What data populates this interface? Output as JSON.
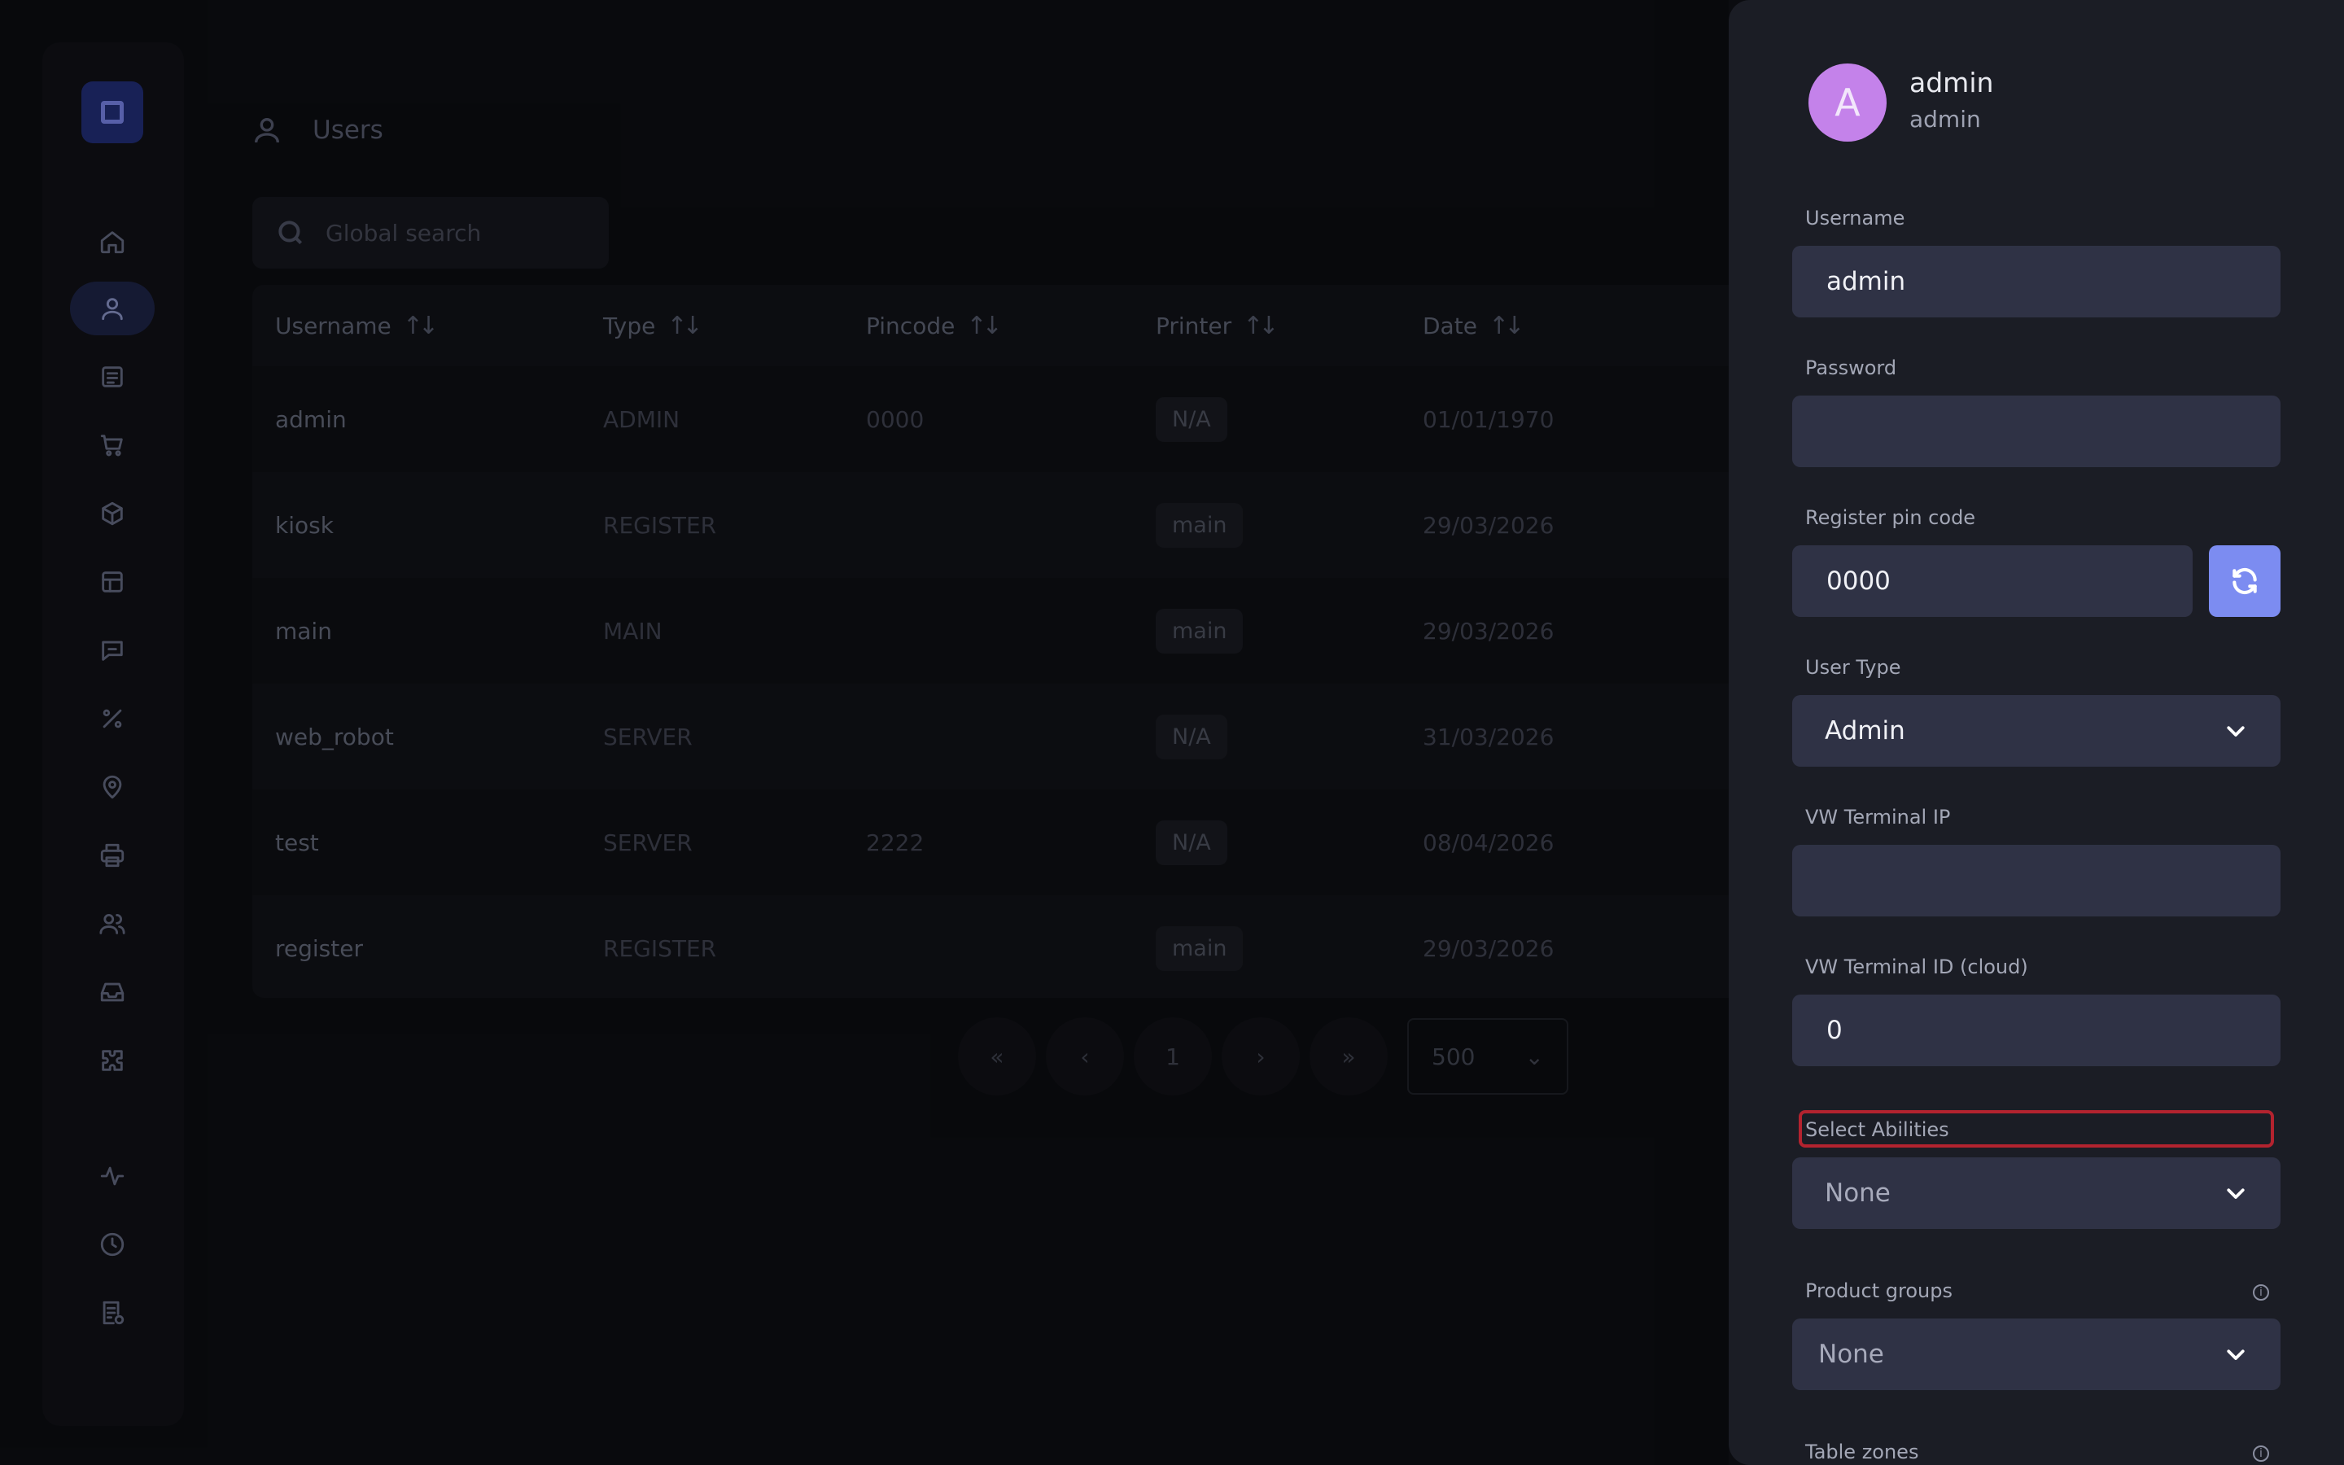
{
  "header": {
    "title": "Users",
    "search_placeholder": "Global search"
  },
  "sidebar": {
    "items": [
      {
        "icon": "home-icon"
      },
      {
        "icon": "user-icon",
        "active": true
      },
      {
        "icon": "receipt-icon"
      },
      {
        "icon": "cart-icon"
      },
      {
        "icon": "package-icon"
      },
      {
        "icon": "table-icon"
      },
      {
        "icon": "message-icon"
      },
      {
        "icon": "percent-icon"
      },
      {
        "icon": "location-icon"
      },
      {
        "icon": "printer-icon"
      },
      {
        "icon": "users-icon"
      },
      {
        "icon": "inbox-icon"
      },
      {
        "icon": "puzzle-icon"
      },
      {
        "icon": "activity-icon"
      },
      {
        "icon": "clock-icon"
      },
      {
        "icon": "report-icon"
      }
    ]
  },
  "table": {
    "columns": [
      "Username",
      "Type",
      "Pincode",
      "Printer",
      "Date"
    ],
    "rows": [
      {
        "username": "admin",
        "type": "ADMIN",
        "pincode": "0000",
        "printer": "N/A",
        "date": "01/01/1970"
      },
      {
        "username": "kiosk",
        "type": "REGISTER",
        "pincode": "",
        "printer": "main",
        "date": "29/03/2026"
      },
      {
        "username": "main",
        "type": "MAIN",
        "pincode": "",
        "printer": "main",
        "date": "29/03/2026"
      },
      {
        "username": "web_robot",
        "type": "SERVER",
        "pincode": "",
        "printer": "N/A",
        "date": "31/03/2026"
      },
      {
        "username": "test",
        "type": "SERVER",
        "pincode": "2222",
        "printer": "N/A",
        "date": "08/04/2026"
      },
      {
        "username": "register",
        "type": "REGISTER",
        "pincode": "",
        "printer": "main",
        "date": "29/03/2026"
      }
    ]
  },
  "pagination": {
    "first": "«",
    "prev": "‹",
    "current": "1",
    "next": "›",
    "last": "»",
    "page_size": "500"
  },
  "drawer": {
    "avatar_letter": "A",
    "name": "admin",
    "subtitle": "admin",
    "username_label": "Username",
    "username_value": "admin",
    "password_label": "Password",
    "password_value": "",
    "pin_label": "Register pin code",
    "pin_value": "0000",
    "user_type_label": "User Type",
    "user_type_value": "Admin",
    "terminal_ip_label": "VW Terminal IP",
    "terminal_ip_value": "",
    "terminal_id_label": "VW Terminal ID (cloud)",
    "terminal_id_value": "0",
    "abilities_label": "Select Abilities",
    "abilities_value": "None",
    "product_groups_label": "Product groups",
    "product_groups_value": "None",
    "table_zones_label": "Table zones"
  },
  "colors": {
    "accent": "#7c8cf1",
    "avatar": "#c482ea",
    "highlight": "#b3232f"
  }
}
